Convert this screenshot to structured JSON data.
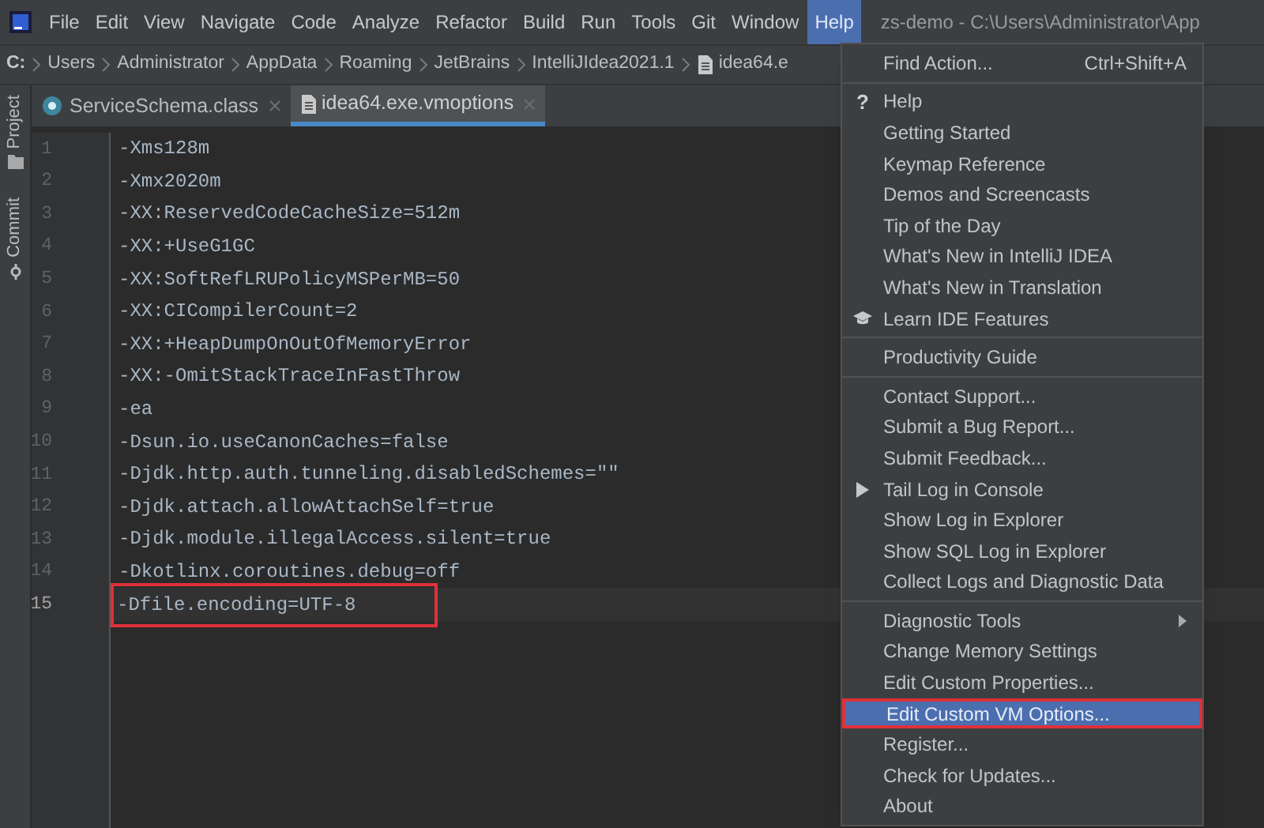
{
  "window": {
    "title": "zs-demo - C:\\Users\\Administrator\\App"
  },
  "menubar": [
    {
      "label": "File",
      "selected": false
    },
    {
      "label": "Edit",
      "selected": false
    },
    {
      "label": "View",
      "selected": false
    },
    {
      "label": "Navigate",
      "selected": false
    },
    {
      "label": "Code",
      "selected": false
    },
    {
      "label": "Analyze",
      "selected": false
    },
    {
      "label": "Refactor",
      "selected": false
    },
    {
      "label": "Build",
      "selected": false
    },
    {
      "label": "Run",
      "selected": false
    },
    {
      "label": "Tools",
      "selected": false
    },
    {
      "label": "Git",
      "selected": false
    },
    {
      "label": "Window",
      "selected": false
    },
    {
      "label": "Help",
      "selected": true
    }
  ],
  "breadcrumb": [
    {
      "label": "C:",
      "kind": "drive"
    },
    {
      "label": "Users",
      "kind": "folder"
    },
    {
      "label": "Administrator",
      "kind": "folder"
    },
    {
      "label": "AppData",
      "kind": "folder"
    },
    {
      "label": "Roaming",
      "kind": "folder"
    },
    {
      "label": "JetBrains",
      "kind": "folder"
    },
    {
      "label": "IntelliJIdea2021.1",
      "kind": "folder"
    },
    {
      "label": "idea64.e",
      "kind": "file"
    }
  ],
  "side_tools": [
    {
      "label": "Project",
      "kind": "folder"
    },
    {
      "label": "Commit",
      "kind": "commit"
    }
  ],
  "tabs": [
    {
      "label": "ServiceSchema.class",
      "kind": "class",
      "selected": false
    },
    {
      "label": "idea64.exe.vmoptions",
      "kind": "file",
      "selected": true
    }
  ],
  "editor": {
    "lines": [
      {
        "number": "1",
        "text": "-Xms128m",
        "current": false,
        "annotated": false
      },
      {
        "number": "2",
        "text": "-Xmx2020m",
        "current": false,
        "annotated": false
      },
      {
        "number": "3",
        "text": "-XX:ReservedCodeCacheSize=512m",
        "current": false,
        "annotated": false
      },
      {
        "number": "4",
        "text": "-XX:+UseG1GC",
        "current": false,
        "annotated": false
      },
      {
        "number": "5",
        "text": "-XX:SoftRefLRUPolicyMSPerMB=50",
        "current": false,
        "annotated": false
      },
      {
        "number": "6",
        "text": "-XX:CICompilerCount=2",
        "current": false,
        "annotated": false
      },
      {
        "number": "7",
        "text": "-XX:+HeapDumpOnOutOfMemoryError",
        "current": false,
        "annotated": false
      },
      {
        "number": "8",
        "text": "-XX:-OmitStackTraceInFastThrow",
        "current": false,
        "annotated": false
      },
      {
        "number": "9",
        "text": "-ea",
        "current": false,
        "annotated": false
      },
      {
        "number": "10",
        "text": "-Dsun.io.useCanonCaches=false",
        "current": false,
        "annotated": false
      },
      {
        "number": "11",
        "text": "-Djdk.http.auth.tunneling.disabledSchemes=\"\"",
        "current": false,
        "annotated": false
      },
      {
        "number": "12",
        "text": "-Djdk.attach.allowAttachSelf=true",
        "current": false,
        "annotated": false
      },
      {
        "number": "13",
        "text": "-Djdk.module.illegalAccess.silent=true",
        "current": false,
        "annotated": false
      },
      {
        "number": "14",
        "text": "-Dkotlinx.coroutines.debug=off",
        "current": false,
        "annotated": false
      },
      {
        "number": "15",
        "text": "-Dfile.encoding=UTF-8",
        "current": true,
        "annotated": true
      }
    ]
  },
  "help_menu": {
    "groups": [
      [
        {
          "label": "Find Action...",
          "shortcut": "Ctrl+Shift+A",
          "selected": false,
          "annotated": false
        }
      ],
      [
        {
          "label": "Help",
          "kind": "glyph",
          "glyph": "?",
          "selected": false,
          "annotated": false
        },
        {
          "label": "Getting Started",
          "selected": false,
          "annotated": false
        },
        {
          "label": "Keymap Reference",
          "selected": false,
          "annotated": false
        },
        {
          "label": "Demos and Screencasts",
          "selected": false,
          "annotated": false
        },
        {
          "label": "Tip of the Day",
          "selected": false,
          "annotated": false
        },
        {
          "label": "What's New in IntelliJ IDEA",
          "selected": false,
          "annotated": false
        },
        {
          "label": "What's New in Translation",
          "selected": false,
          "annotated": false
        },
        {
          "label": "Learn IDE Features",
          "kind": "learn",
          "selected": false,
          "annotated": false
        }
      ],
      [
        {
          "label": "Productivity Guide",
          "selected": false,
          "annotated": false
        }
      ],
      [
        {
          "label": "Contact Support...",
          "selected": false,
          "annotated": false
        },
        {
          "label": "Submit a Bug Report...",
          "selected": false,
          "annotated": false
        },
        {
          "label": "Submit Feedback...",
          "selected": false,
          "annotated": false
        },
        {
          "label": "Tail Log in Console",
          "kind": "tail",
          "selected": false,
          "annotated": false
        },
        {
          "label": "Show Log in Explorer",
          "selected": false,
          "annotated": false
        },
        {
          "label": "Show SQL Log in Explorer",
          "selected": false,
          "annotated": false
        },
        {
          "label": "Collect Logs and Diagnostic Data",
          "selected": false,
          "annotated": false
        }
      ],
      [
        {
          "label": "Diagnostic Tools",
          "submenu": true,
          "selected": false,
          "annotated": false
        },
        {
          "label": "Change Memory Settings",
          "selected": false,
          "annotated": false
        },
        {
          "label": "Edit Custom Properties...",
          "selected": false,
          "annotated": false
        },
        {
          "label": "Edit Custom VM Options...",
          "selected": true,
          "annotated": true
        },
        {
          "label": "Register...",
          "selected": false,
          "annotated": false
        },
        {
          "label": "Check for Updates...",
          "selected": false,
          "annotated": false
        },
        {
          "label": "About",
          "selected": false,
          "annotated": false
        }
      ]
    ]
  }
}
